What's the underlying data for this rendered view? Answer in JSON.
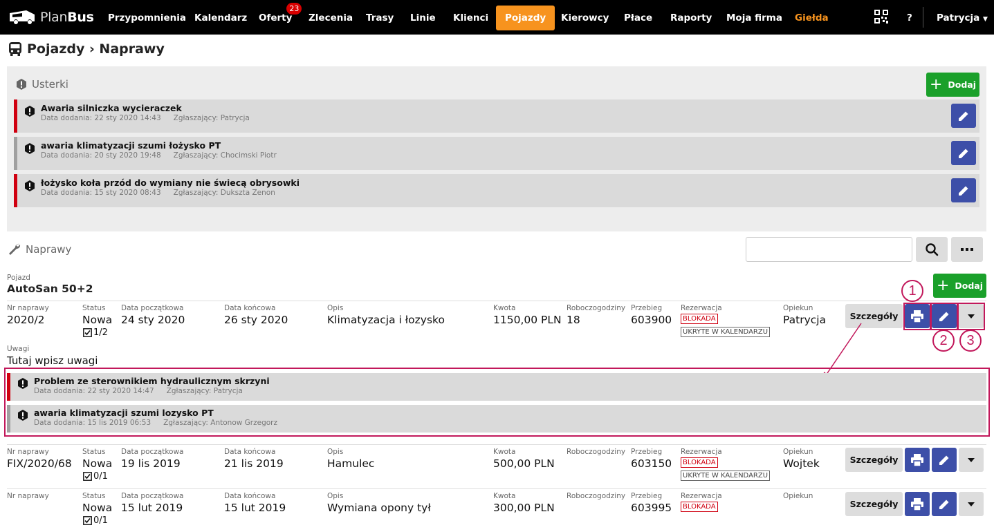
{
  "app": {
    "brand_plan": "Plan",
    "brand_bus": "Bus"
  },
  "nav": {
    "items": [
      "Przypomnienia",
      "Kalendarz",
      "Oferty",
      "Zlecenia",
      "Trasy",
      "Linie",
      "Klienci",
      "Pojazdy",
      "Kierowcy",
      "Płace",
      "Raporty",
      "Moja firma",
      "Giełda"
    ],
    "offers_badge": "23",
    "help": "?",
    "user": "Patrycja",
    "active_color": "#f7931e"
  },
  "page": {
    "title": "Pojazdy › Naprawy"
  },
  "defects": {
    "title": "Usterki",
    "add_label": "Dodaj",
    "items": [
      {
        "title": "Awaria silniczka wycieraczek",
        "date": "Data dodania: 22 sty 2020 14:43",
        "reporter": "Zgłaszający: Patrycja"
      },
      {
        "title": "awaria klimatyzacji szumi łożysko PT",
        "date": "Data dodania: 20 sty 2020 19:48",
        "reporter": "Zgłaszający: Chocimski Piotr"
      },
      {
        "title": "łożysko koła przód do wymiany nie świecą obrysowki",
        "date": "Data dodania: 15 sty 2020 08:43",
        "reporter": "Zgłaszający: Dukszta Zenon"
      }
    ]
  },
  "repairs": {
    "title": "Naprawy",
    "search_placeholder": "",
    "vehicle_label": "Pojazd",
    "vehicle_name": "AutoSan 50+2",
    "add_label": "Dodaj",
    "labels": {
      "nr": "Nr naprawy",
      "status": "Status",
      "start": "Data początkowa",
      "end": "Data końcowa",
      "desc": "Opis",
      "amount": "Kwota",
      "hours": "Roboczogodziny",
      "mileage": "Przebieg",
      "reservation": "Rezerwacja",
      "keeper": "Opiekun",
      "notes": "Uwagi"
    },
    "details_label": "Szczegóły",
    "rows": [
      {
        "nr": "2020/2",
        "status": "Nowa",
        "check": "1/2",
        "start": "24 sty 2020",
        "end": "26 sty 2020",
        "desc": "Klimatyzacja i łozysko",
        "amount": "1150,00 PLN",
        "hours": "18",
        "mileage": "603900",
        "tag1": "BLOKADA",
        "tag2": "UKRYTE W KALENDARZU",
        "keeper": "Patrycja",
        "notes": "Tutaj wpisz uwagi"
      },
      {
        "nr": "FIX/2020/68",
        "status": "Nowa",
        "check": "0/1",
        "start": "19 lis 2019",
        "end": "21 lis 2019",
        "desc": "Hamulec",
        "amount": "500,00 PLN",
        "hours": "",
        "mileage": "603150",
        "tag1": "BLOKADA",
        "tag2": "UKRYTE W KALENDARZU",
        "keeper": "Wojtek"
      },
      {
        "nr": "",
        "status": "Nowa",
        "check": "0/1",
        "start": "15 lut 2019",
        "end": "15 lut 2019",
        "desc": "Wymiana opony tył",
        "amount": "300,00 PLN",
        "hours": "",
        "mileage": "603995",
        "tag1": "BLOKADA",
        "keeper": ""
      }
    ],
    "linked_defects": [
      {
        "title": "Problem ze sterownikiem hydraulicznym skrzyni",
        "date": "Data dodania: 22 sty 2020 14:47",
        "reporter": "Zgłaszający: Patrycja"
      },
      {
        "title": "awaria klimatyzacji szumi lozysko PT",
        "date": "Data dodania: 15 lis 2019 06:53",
        "reporter": "Zgłaszający: Antonow Grzegorz"
      }
    ]
  },
  "callouts": [
    "1",
    "2",
    "3"
  ],
  "colors": {
    "green": "#1aa02a",
    "blue": "#3d4fa8",
    "red": "#d00010",
    "highlight": "#c2185b"
  }
}
